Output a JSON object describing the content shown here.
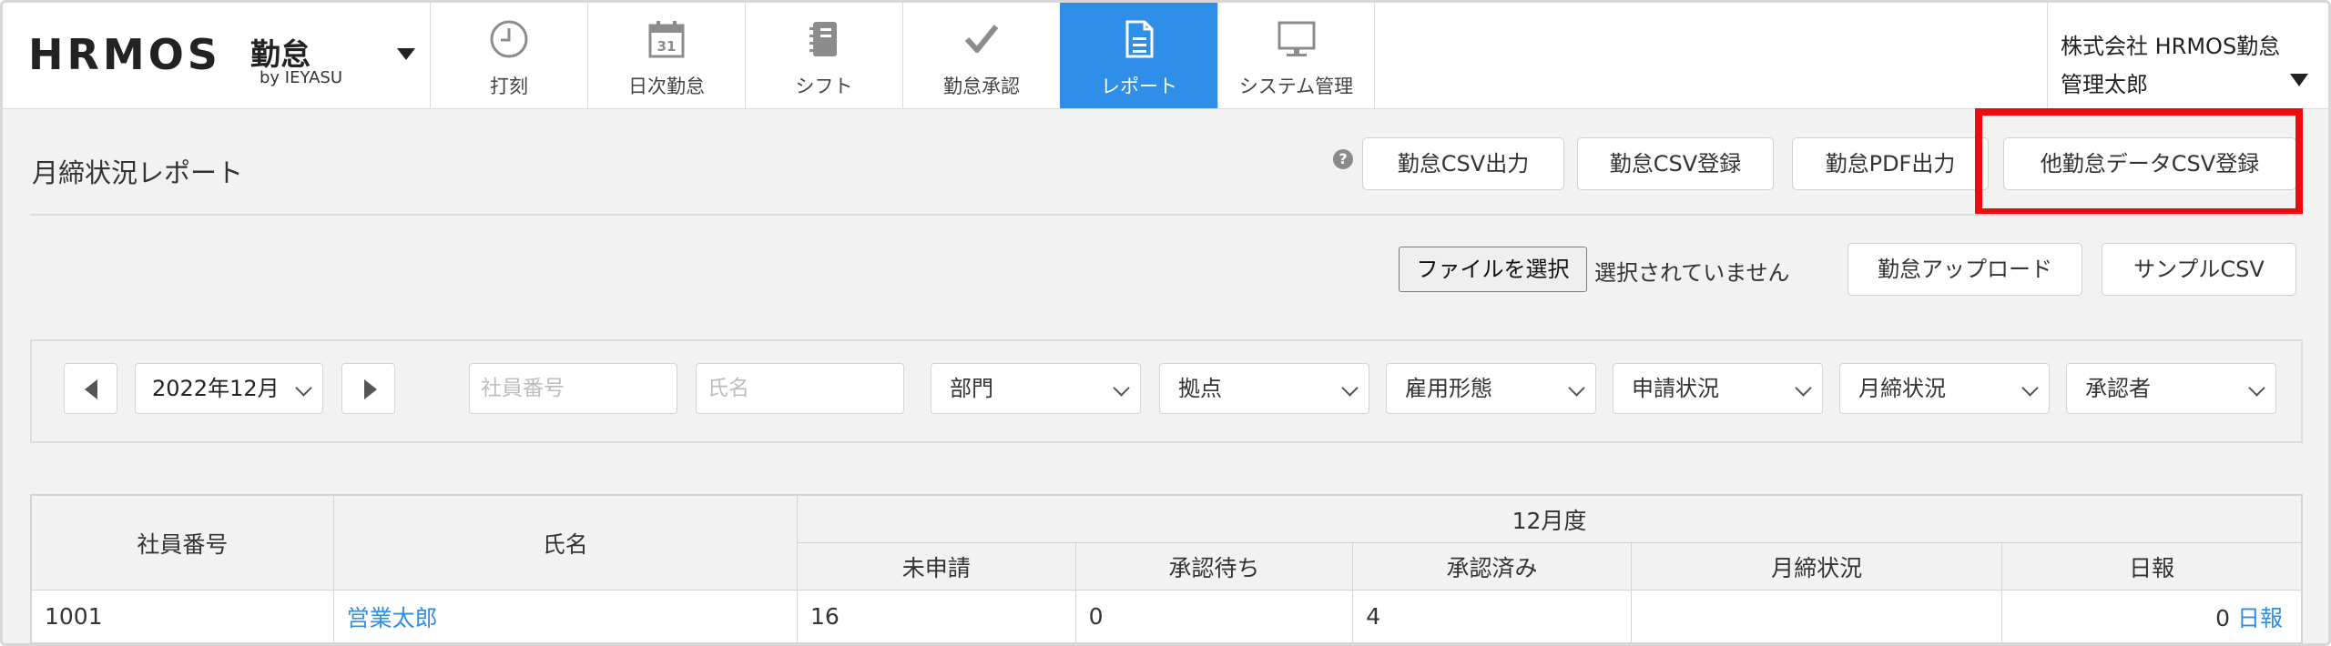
{
  "header": {
    "logo": {
      "main": "HRMOS",
      "sub": "勤怠",
      "by": "by IEYASU"
    },
    "nav": [
      {
        "label": "打刻",
        "icon": "clock-icon"
      },
      {
        "label": "日次勤怠",
        "icon": "calendar-icon",
        "badge": "31"
      },
      {
        "label": "シフト",
        "icon": "notebook-icon"
      },
      {
        "label": "勤怠承認",
        "icon": "checkmark-icon"
      },
      {
        "label": "レポート",
        "icon": "document-icon",
        "active": true
      },
      {
        "label": "システム管理",
        "icon": "monitor-icon"
      }
    ],
    "user": {
      "company": "株式会社 HRMOS勤怠",
      "name": "管理太郎"
    }
  },
  "page": {
    "title": "月締状況レポート",
    "help_icon": "?",
    "buttons": {
      "csv_export": "勤怠CSV出力",
      "csv_import": "勤怠CSV登録",
      "pdf_export": "勤怠PDF出力",
      "other_csv_import": "他勤怠データCSV登録"
    },
    "file": {
      "choose_label": "ファイルを選択",
      "status": "選択されていません",
      "upload": "勤怠アップロード",
      "sample": "サンプルCSV"
    }
  },
  "filters": {
    "month": "2022年12月",
    "employee_number_placeholder": "社員番号",
    "name_placeholder": "氏名",
    "selects": [
      "部門",
      "拠点",
      "雇用形態",
      "申請状況",
      "月締状況",
      "承認者"
    ]
  },
  "table": {
    "headers": {
      "employee_number": "社員番号",
      "name": "氏名",
      "period": "12月度",
      "unsubmitted": "未申請",
      "pending": "承認待ち",
      "approved": "承認済み",
      "closing_status": "月締状況",
      "daily_report": "日報"
    },
    "rows": [
      {
        "employee_number": "1001",
        "name": "営業太郎",
        "unsubmitted": "16",
        "pending": "0",
        "approved": "4",
        "closing_status": "",
        "daily_count": "0",
        "daily_link": "日報"
      }
    ]
  },
  "colors": {
    "accent": "#2e8ee8",
    "highlight": "#ee0b0b"
  }
}
